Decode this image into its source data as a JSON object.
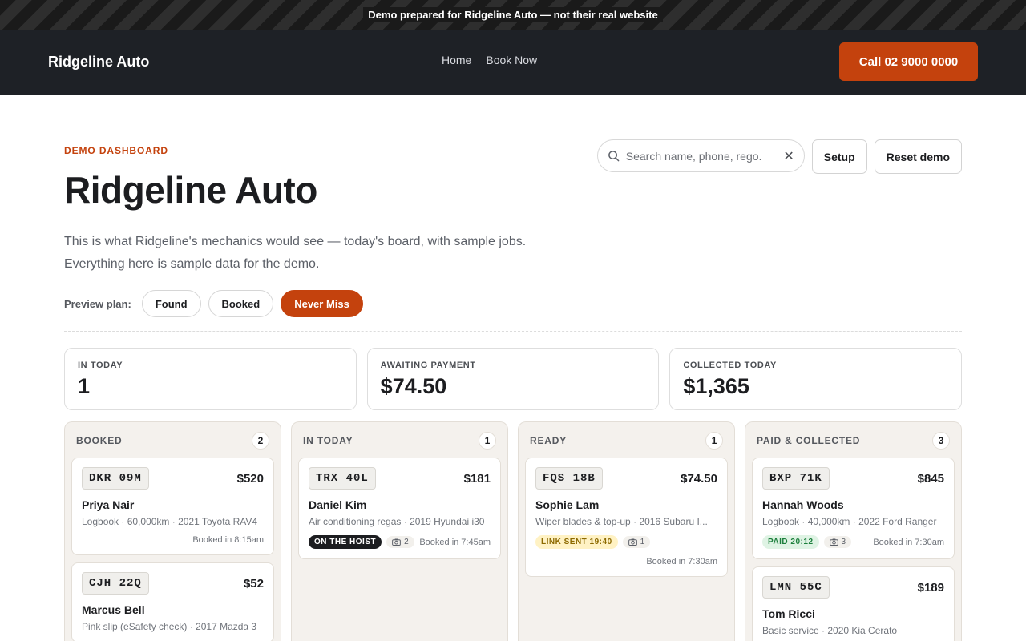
{
  "banner": {
    "text": "Demo prepared for Ridgeline Auto — not their real website"
  },
  "header": {
    "brand": "Ridgeline Auto",
    "nav": [
      "Home",
      "Book Now"
    ],
    "call_label": "Call 02 9000 0000"
  },
  "hero": {
    "eyebrow": "DEMO DASHBOARD",
    "title": "Ridgeline Auto",
    "desc_line1": "This is what Ridgeline's mechanics would see — today's board, with sample jobs.",
    "desc_line2": "Everything here is sample data for the demo."
  },
  "toolbar": {
    "search_placeholder": "Search name, phone, rego.",
    "clear_icon": "✕",
    "setup_label": "Setup",
    "reset_label": "Reset demo"
  },
  "plan": {
    "label": "Preview plan:",
    "options": [
      "Found",
      "Booked",
      "Never Miss"
    ],
    "active": "Never Miss"
  },
  "stats": [
    {
      "label": "IN TODAY",
      "value": "1"
    },
    {
      "label": "AWAITING PAYMENT",
      "value": "$74.50"
    },
    {
      "label": "COLLECTED TODAY",
      "value": "$1,365"
    }
  ],
  "columns": [
    {
      "title": "BOOKED",
      "count": "2",
      "cards": [
        {
          "rego": "DKR 09M",
          "price": "$520",
          "name": "Priya Nair",
          "job": "Logbook · 60,000km · 2021 Toyota RAV4",
          "booked": "Booked in 8:15am"
        },
        {
          "rego": "CJH 22Q",
          "price": "$52",
          "name": "Marcus Bell",
          "job": "Pink slip (eSafety check) · 2017 Mazda 3"
        }
      ]
    },
    {
      "title": "IN TODAY",
      "count": "1",
      "cards": [
        {
          "rego": "TRX 40L",
          "price": "$181",
          "name": "Daniel Kim",
          "job": "Air conditioning regas · 2019 Hyundai i30",
          "badge": "ON THE HOIST",
          "photos": "2",
          "booked": "Booked in 7:45am"
        }
      ]
    },
    {
      "title": "READY",
      "count": "1",
      "cards": [
        {
          "rego": "FQS 18B",
          "price": "$74.50",
          "name": "Sophie Lam",
          "job": "Wiper blades & top-up · 2016 Subaru I...",
          "badge": "LINK SENT 19:40",
          "photos": "1",
          "booked": "Booked in 7:30am"
        }
      ]
    },
    {
      "title": "PAID & COLLECTED",
      "count": "3",
      "cards": [
        {
          "rego": "BXP 71K",
          "price": "$845",
          "name": "Hannah Woods",
          "job": "Logbook · 40,000km · 2022 Ford Ranger",
          "badge": "PAID 20:12",
          "photos": "3",
          "booked": "Booked in 7:30am"
        },
        {
          "rego": "LMN 55C",
          "price": "$189",
          "name": "Tom Ricci",
          "job": "Basic service · 2020 Kia Cerato"
        }
      ]
    }
  ],
  "colors": {
    "accent": "#c4420d",
    "header_bg": "#1e2126",
    "column_bg": "#f4f1ed"
  }
}
